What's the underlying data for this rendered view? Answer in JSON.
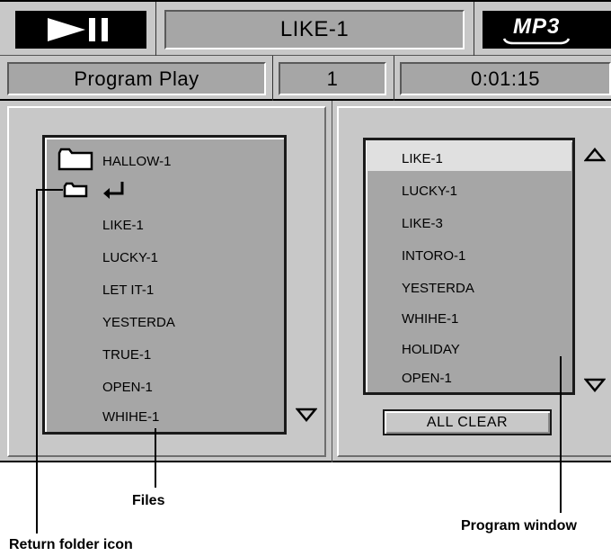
{
  "header": {
    "track_title": "LIKE-1",
    "format_logo": "MP3"
  },
  "status": {
    "mode": "Program Play",
    "track_number": "1",
    "elapsed_time": "0:01:15"
  },
  "file_browser": {
    "current_folder": "HALLOW-1",
    "files": [
      "LIKE-1",
      "LUCKY-1",
      "LET IT-1",
      "YESTERDA",
      "TRUE-1",
      "OPEN-1",
      "WHIHE-1"
    ]
  },
  "program_window": {
    "items": [
      "LIKE-1",
      "LUCKY-1",
      "LIKE-3",
      "INTORO-1",
      "YESTERDA",
      "WHIHE-1",
      "HOLIDAY",
      "OPEN-1"
    ],
    "selected_index": 0,
    "all_clear_label": "ALL CLEAR"
  },
  "callouts": {
    "files": "Files",
    "return_folder_icon": "Return folder icon",
    "program_window": "Program window"
  },
  "icons": {
    "play_pause": "play-pause-icon",
    "folder": "folder-icon",
    "return_folder": "return-folder-icon",
    "return_arrow": "return-arrow-icon",
    "scroll_up": "triangle-up-icon",
    "scroll_down": "triangle-down-icon"
  },
  "colors": {
    "panel_bg": "#c8c8c8",
    "list_bg": "#a6a6a6",
    "selection_bg": "#e0e0e0"
  }
}
